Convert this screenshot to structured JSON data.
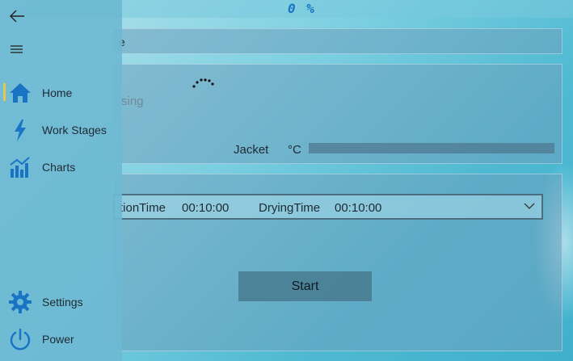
{
  "header": {
    "progress_text": "0 %"
  },
  "nav": {
    "items": [
      {
        "label": "Home",
        "icon": "home-icon"
      },
      {
        "label": "Work Stages",
        "icon": "lightning-icon"
      },
      {
        "label": "Charts",
        "icon": "chart-icon"
      }
    ],
    "footer_items": [
      {
        "label": "Settings",
        "icon": "gear-icon"
      },
      {
        "label": "Power",
        "icon": "power-icon"
      }
    ],
    "accent_color": "#1a74c4",
    "selected_indicator_color": "#e6c94a"
  },
  "main": {
    "top_panel_text": "e",
    "status_text": "sing",
    "jacket": {
      "label": "Jacket",
      "unit": "°C"
    },
    "recipe": {
      "label1": "tionTime",
      "value1": "00:10:00",
      "label2": "DryingTime",
      "value2": "00:10:00"
    },
    "start_label": "Start"
  }
}
